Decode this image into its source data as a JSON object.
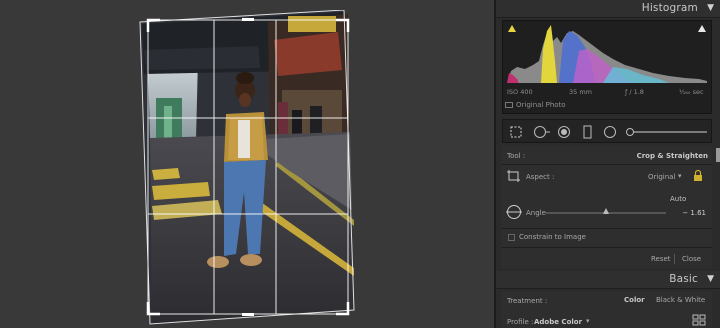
{
  "histogram": {
    "title": "Histogram",
    "iso": "ISO 400",
    "focal": "35 mm",
    "aperture": "ƒ / 1.8",
    "shutter": "¹⁄₁₆₀ sec",
    "original_photo": "Original Photo"
  },
  "tool": {
    "label": "Tool :",
    "name": "Crop & Straighten",
    "aspect_label": "Aspect :",
    "aspect_value": "Original",
    "auto": "Auto",
    "angle_label": "Angle",
    "angle_value": "− 1.61",
    "angle_slider": 0.5,
    "constrain": "Constrain to Image",
    "reset": "Reset",
    "close": "Close"
  },
  "basic": {
    "title": "Basic",
    "treatment_label": "Treatment :",
    "color": "Color",
    "bw": "Black & White",
    "profile_label": "Profile :",
    "profile_value": "Adobe Color"
  },
  "colors": {
    "accent_yellow": "#e8d640",
    "panel_bg": "#2b2b2b",
    "canvas_bg": "#393939"
  }
}
